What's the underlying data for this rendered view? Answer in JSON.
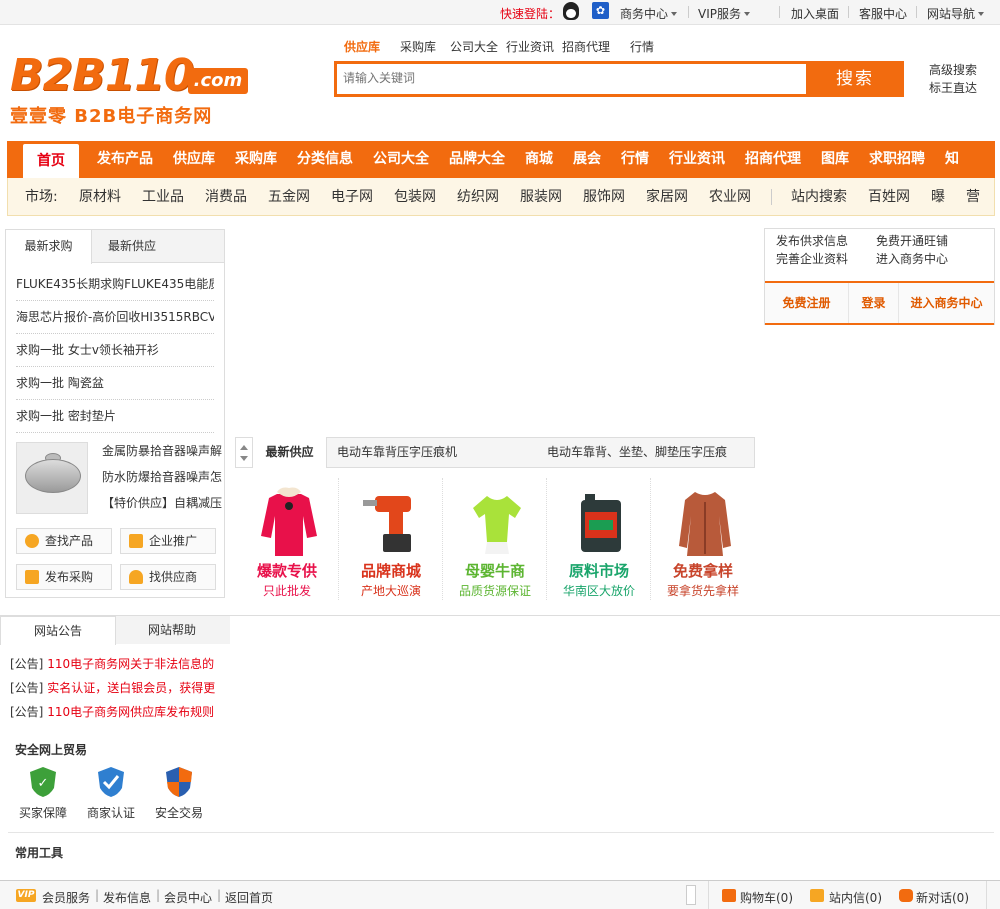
{
  "topbar": {
    "quick_login": "快速登陆：",
    "links": [
      "商务中心",
      "VIP服务",
      "加入桌面",
      "客服中心",
      "网站导航"
    ]
  },
  "logo": {
    "main": "B2B110",
    "domain": ".com",
    "slogan": "壹壹零  B2B电子商务网"
  },
  "search": {
    "tabs": [
      "供应库",
      "采购库",
      "公司大全",
      "行业资讯",
      "招商代理",
      "行情"
    ],
    "active_tab": "供应库",
    "placeholder": "请输入关键词",
    "button": "搜索",
    "advanced": "高级搜索",
    "direct": "标王直达"
  },
  "nav": {
    "items": [
      "首页",
      "发布产品",
      "供应库",
      "采购库",
      "分类信息",
      "公司大全",
      "品牌大全",
      "商城",
      "展会",
      "行情",
      "行业资讯",
      "招商代理",
      "图库",
      "求职招聘",
      "知"
    ]
  },
  "market": {
    "label": "市场:",
    "items": [
      "原材料",
      "工业品",
      "消费品",
      "五金网",
      "电子网",
      "包装网",
      "纺织网",
      "服装网",
      "服饰网",
      "家居网",
      "农业网"
    ],
    "right_items": [
      "站内搜索",
      "百姓网",
      "曝",
      "营"
    ]
  },
  "left_panel": {
    "tabs": [
      "最新求购",
      "最新供应"
    ],
    "rows": [
      "FLUKE435长期求购FLUKE435电能质",
      "海思芯片报价-高价回收HI3515RBCV",
      "求购一批 女士v领长袖开衫",
      "求购一批 陶瓷盆",
      "求购一批 密封垫片"
    ],
    "products": [
      "金属防暴拾音器噪声解",
      "防水防爆拾音器噪声怎",
      "【特价供应】自耦减压"
    ],
    "buttons": [
      "查找产品",
      "企业推广",
      "发布采购",
      "找供应商"
    ]
  },
  "supply": {
    "label": "最新供应",
    "items": [
      "电动车靠背压字压痕机",
      "电动车靠背、坐垫、脚垫压字压痕"
    ]
  },
  "promos": [
    {
      "title": "爆款专供",
      "sub": "只此批发",
      "color": "#e8114a"
    },
    {
      "title": "品牌商城",
      "sub": "产地大巡演",
      "color": "#d9321b"
    },
    {
      "title": "母婴牛商",
      "sub": "品质货源保证",
      "color": "#5cb531"
    },
    {
      "title": "原料市场",
      "sub": "华南区大放价",
      "color": "#1aa56b"
    },
    {
      "title": "免费拿样",
      "sub": "要拿货先拿样",
      "color": "#c8452c"
    }
  ],
  "right_panel": {
    "links": [
      "发布供求信息",
      "免费开通旺铺",
      "完善企业资料",
      "进入商务中心"
    ],
    "buttons": [
      "免费注册",
      "登录",
      "进入商务中心"
    ]
  },
  "notice": {
    "tabs": [
      "网站公告",
      "网站帮助"
    ],
    "lines": [
      {
        "prefix": "[公告]",
        "text": "110电子商务网关于非法信息的"
      },
      {
        "prefix": "[公告]",
        "text": "实名认证，送白银会员，获得更"
      },
      {
        "prefix": "[公告]",
        "text": "110电子商务网供应库发布规则"
      }
    ],
    "safe_title": "安全网上贸易",
    "safe_items": [
      "买家保障",
      "商家认证",
      "安全交易"
    ],
    "tools_title": "常用工具"
  },
  "bottombar": {
    "left": [
      "会员服务",
      "发布信息",
      "会员中心",
      "返回首页"
    ],
    "cart": "购物车(0)",
    "mail": "站内信(0)",
    "chat": "新对话(0)"
  },
  "colors": {
    "brand": "#f26b0f",
    "alert": "#e60012"
  }
}
